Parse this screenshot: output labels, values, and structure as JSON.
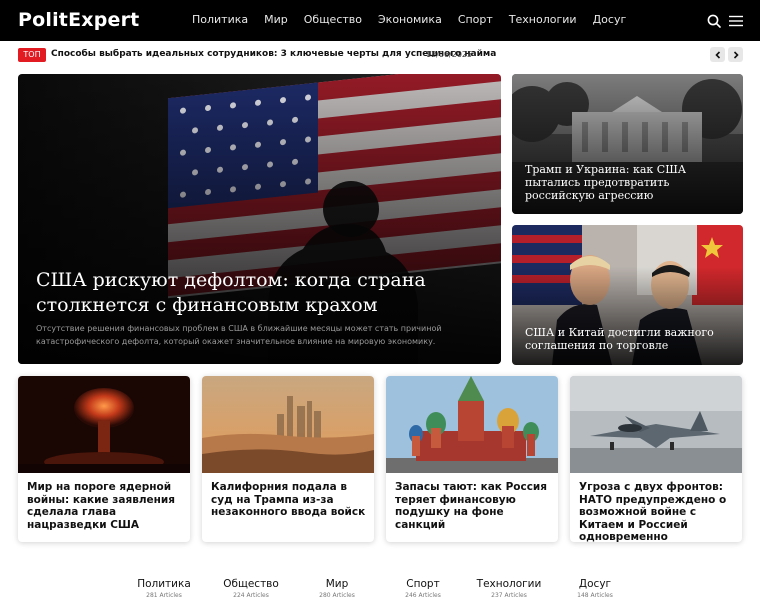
{
  "site": {
    "logo": "PolitExpert"
  },
  "nav": {
    "items": [
      {
        "label": "Политика"
      },
      {
        "label": "Мир"
      },
      {
        "label": "Общество"
      },
      {
        "label": "Экономика"
      },
      {
        "label": "Спорт"
      },
      {
        "label": "Технологии"
      },
      {
        "label": "Досуг"
      }
    ]
  },
  "icons": {
    "search": "search-icon",
    "menu": "hamburger-menu-icon",
    "prev": "chevron-left-icon",
    "next": "chevron-right-icon"
  },
  "ticker": {
    "badge": "ТОП",
    "title": "Способы выбрать идеальных сотрудников: 3 ключевые черты для успешного найма",
    "date": "12/06/2025"
  },
  "hero": {
    "title": "США рискуют дефолтом: когда страна столкнется с финансовым крахом",
    "excerpt": "Отсутствие решения финансовых проблем в США в ближайшие месяцы может стать причиной катастрофического дефолта, который окажет значительное влияние на мировую экономику."
  },
  "side": [
    {
      "title": "Трамп и Украина: как США пытались предотвратить российскую агрессию"
    },
    {
      "title": "США и Китай достигли важного соглашения по торговле"
    }
  ],
  "cards": [
    {
      "title": "Мир на пороге ядерной войны: какие заявления сделала глава нацразведки США"
    },
    {
      "title": "Калифорния подала в суд на Трампа из-за незаконного ввода войск"
    },
    {
      "title": "Запасы тают: как Россия теряет финансовую подушку на фоне санкций"
    },
    {
      "title": "Угроза с двух фронтов: НАТО предупреждено о возможной войне с Китаем и Россией одновременно"
    }
  ],
  "categories": [
    {
      "name": "Политика",
      "count": "281 Articles"
    },
    {
      "name": "Общество",
      "count": "224 Articles"
    },
    {
      "name": "Мир",
      "count": "280 Articles"
    },
    {
      "name": "Спорт",
      "count": "246 Articles"
    },
    {
      "name": "Технологии",
      "count": "237 Articles"
    },
    {
      "name": "Досуг",
      "count": "148 Articles"
    }
  ],
  "colors": {
    "header_bg": "#000000",
    "accent_red": "#e21b23",
    "ticker_arrow_bg": "#e7e7e7"
  }
}
